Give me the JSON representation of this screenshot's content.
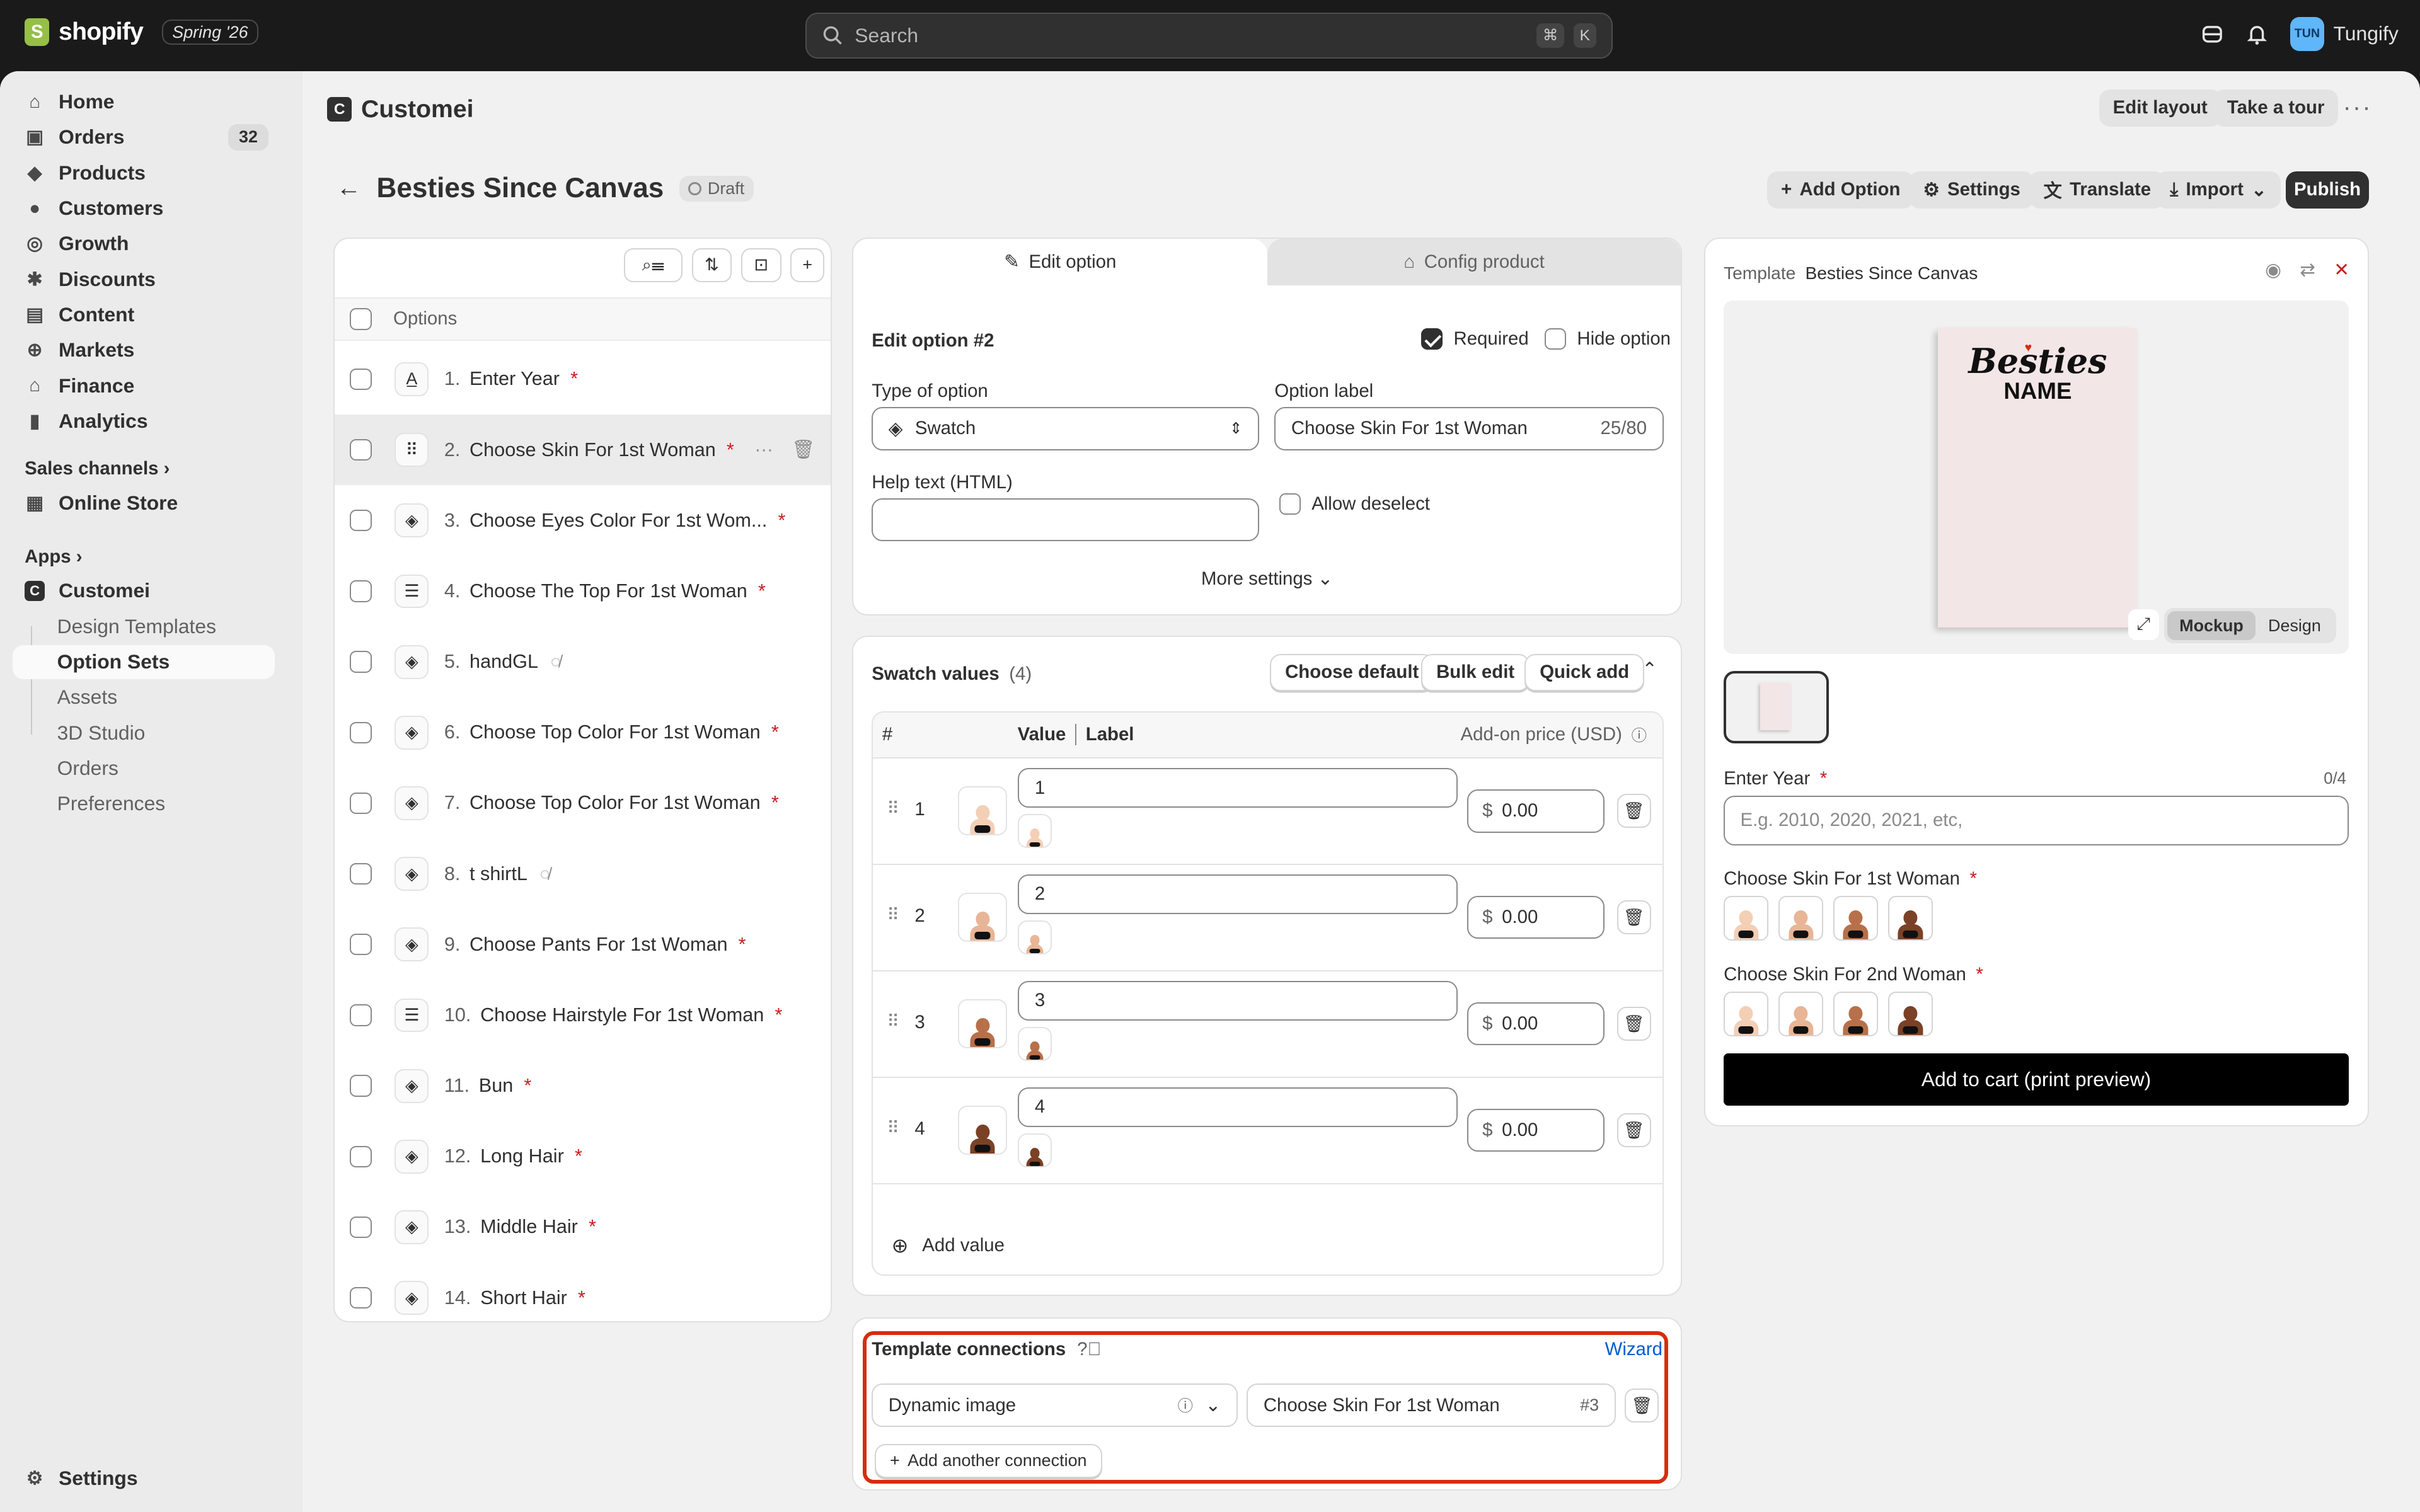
{
  "topbar": {
    "brand": "shopify",
    "edition": "Spring '26",
    "search_placeholder": "Search",
    "kbd1": "⌘",
    "kbd2": "K",
    "avatar_initials": "TUN",
    "store_name": "Tungify"
  },
  "sidebar": {
    "items": [
      {
        "label": "Home"
      },
      {
        "label": "Orders",
        "badge": "32"
      },
      {
        "label": "Products"
      },
      {
        "label": "Customers"
      },
      {
        "label": "Growth"
      },
      {
        "label": "Discounts"
      },
      {
        "label": "Content"
      },
      {
        "label": "Markets"
      },
      {
        "label": "Finance"
      },
      {
        "label": "Analytics"
      }
    ],
    "sales_channels": "Sales channels",
    "online_store": "Online Store",
    "apps": "Apps",
    "app_name": "Customei",
    "app_subitems": [
      "Design Templates",
      "Option Sets",
      "Assets",
      "3D Studio",
      "Orders",
      "Preferences"
    ],
    "settings": "Settings"
  },
  "app_header": {
    "title": "Customei",
    "edit_layout": "Edit layout",
    "take_tour": "Take a tour"
  },
  "page": {
    "title": "Besties Since Canvas",
    "status": "Draft",
    "add_option": "Add Option",
    "settings": "Settings",
    "translate": "Translate",
    "import": "Import",
    "publish": "Publish"
  },
  "options": {
    "header": "Options",
    "rows": [
      {
        "num": "1.",
        "label": "Enter Year",
        "required": true
      },
      {
        "num": "2.",
        "label": "Choose Skin For 1st Woman",
        "required": true
      },
      {
        "num": "3.",
        "label": "Choose Eyes Color For 1st Wom...",
        "required": true
      },
      {
        "num": "4.",
        "label": "Choose The Top For 1st Woman",
        "required": true
      },
      {
        "num": "5.",
        "label": "handGL",
        "hidden": true
      },
      {
        "num": "6.",
        "label": "Choose Top Color For 1st Woman",
        "required": true
      },
      {
        "num": "7.",
        "label": "Choose Top Color For 1st Woman",
        "required": true
      },
      {
        "num": "8.",
        "label": "t shirtL",
        "hidden": true
      },
      {
        "num": "9.",
        "label": "Choose Pants For 1st Woman",
        "required": true
      },
      {
        "num": "10.",
        "label": "Choose Hairstyle For 1st Woman",
        "required": true
      },
      {
        "num": "11.",
        "label": "Bun",
        "required": true
      },
      {
        "num": "12.",
        "label": "Long Hair",
        "required": true
      },
      {
        "num": "13.",
        "label": "Middle Hair",
        "required": true
      },
      {
        "num": "14.",
        "label": "Short Hair",
        "required": true
      }
    ]
  },
  "editor": {
    "tab_edit": "Edit option",
    "tab_config": "Config product",
    "heading": "Edit option #2",
    "required_label": "Required",
    "hide_option_label": "Hide option",
    "type_label": "Type of option",
    "type_value": "Swatch",
    "option_label_label": "Option label",
    "option_label_value": "Choose Skin For 1st Woman",
    "option_label_count": "25/80",
    "help_text_label": "Help text (HTML)",
    "allow_deselect": "Allow deselect",
    "more_settings": "More settings"
  },
  "swatch": {
    "title": "Swatch values",
    "count": "(4)",
    "choose_default": "Choose default",
    "bulk_edit": "Bulk edit",
    "quick_add": "Quick add",
    "col_hash": "#",
    "col_value": "Value",
    "col_label": "Label",
    "col_price": "Add-on price (USD)",
    "rows": [
      {
        "n": "1",
        "value": "1",
        "currency": "$",
        "price": "0.00",
        "skin": "#f3cfb6"
      },
      {
        "n": "2",
        "value": "2",
        "currency": "$",
        "price": "0.00",
        "skin": "#e8b596"
      },
      {
        "n": "3",
        "value": "3",
        "currency": "$",
        "price": "0.00",
        "skin": "#b7704a"
      },
      {
        "n": "4",
        "value": "4",
        "currency": "$",
        "price": "0.00",
        "skin": "#7a4126"
      }
    ],
    "add_value": "Add value"
  },
  "connections": {
    "title": "Template connections",
    "wizard": "Wizard",
    "type": "Dynamic image",
    "target": "Choose Skin For 1st Woman",
    "target_ref": "#3",
    "add_another": "Add another connection"
  },
  "preview": {
    "template_label": "Template",
    "template_name": "Besties Since Canvas",
    "canvas_line1": "Besties",
    "canvas_line2": "NAME",
    "mode_mockup": "Mockup",
    "mode_design": "Design",
    "enter_year_label": "Enter Year",
    "enter_year_count": "0/4",
    "enter_year_placeholder": "E.g. 2010, 2020, 2021, etc,",
    "skin1_label": "Choose Skin For 1st Woman",
    "skin2_label": "Choose Skin For 2nd Woman",
    "add_to_cart": "Add to cart (print preview)"
  }
}
